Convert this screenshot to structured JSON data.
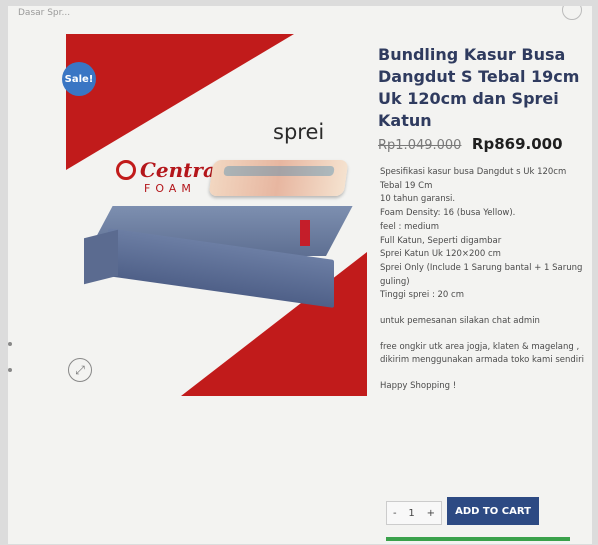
{
  "header": {
    "faint_text": "Dasar Spr..."
  },
  "product": {
    "badge": "Sale!",
    "image_sprei_label": "sprei",
    "brand_name": "Central",
    "brand_sub": "FOAM",
    "title": "Bundling Kasur Busa Dangdut S Tebal 19cm Uk 120cm dan Sprei Katun",
    "price_old": "Rp1.049.000",
    "price_new": "Rp869.000",
    "description_lines": [
      "Spesifikasi kasur busa Dangdut s Uk 120cm",
      "Tebal 19 Cm",
      "10 tahun garansi.",
      "Foam Density: 16 (busa Yellow).",
      "feel : medium",
      "Full Katun, Seperti digambar",
      "Sprei Katun Uk 120×200 cm",
      "Sprei Only (Include 1 Sarung bantal + 1 Sarung guling)",
      "Tinggi sprei : 20 cm",
      "untuk pemesanan silakan chat admin",
      "free ongkir utk area jogja, klaten & magelang ,",
      "dikirim menggunakan armada toko kami sendiri",
      "Happy Shopping !"
    ]
  },
  "cart": {
    "qty_minus": "-",
    "qty_value": "1",
    "qty_plus": "+",
    "add_to_cart_label": "ADD TO CART"
  },
  "colors": {
    "accent_red": "#c11b1b",
    "button_blue": "#2d4a83",
    "title_navy": "#2f3b5f",
    "green_bar": "#3aa14b"
  },
  "icons": [
    "zoom-icon"
  ]
}
